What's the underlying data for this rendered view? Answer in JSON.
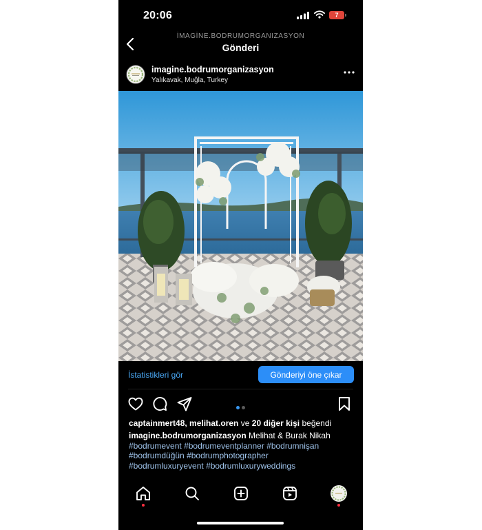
{
  "status_bar": {
    "time": "20:06",
    "battery_level": "7",
    "battery_color": "#e0453a"
  },
  "nav": {
    "back_icon": "chevron-left-icon",
    "subtitle": "İMAGİNE.BODRUMORGANIZASYON",
    "title": "Gönderi"
  },
  "post": {
    "username": "imagine.bodrumorganizasyon",
    "location": "Yalıkavak, Muğla, Turkey",
    "more_icon": "ellipsis-icon",
    "photo_description": "white floral wedding arch on a seaside terrace"
  },
  "insights": {
    "link_label": "İstatistikleri gör",
    "promote_label": "Gönderiyi öne çıkar",
    "accent": "#2c8ef8"
  },
  "actions": {
    "icons": [
      "heart-icon",
      "comment-icon",
      "share-icon",
      "bookmark-icon"
    ],
    "carousel_pages": 2,
    "carousel_active": 1
  },
  "likes": {
    "users": "captainmert48, melihat.oren",
    "connector": "ve",
    "others": "20 diğer kişi",
    "suffix": "beğendi"
  },
  "caption": {
    "username": "imagine.bodrumorganizasyon",
    "text": "Melihat & Burak Nikah",
    "hashtags": [
      "#bodrumevent",
      "#bodrumeventplanner",
      "#bodrumnişan",
      "#bodrumdüğün",
      "#bodrumphotographer",
      "#bodrumluxuryevent",
      "#bodrumluxuryweddings"
    ],
    "hashtag_color": "#9fc3ea"
  },
  "tab_bar": {
    "items": [
      "home-icon",
      "search-icon",
      "create-icon",
      "reels-icon",
      "profile-avatar"
    ],
    "notification_color": "#ff3040"
  }
}
